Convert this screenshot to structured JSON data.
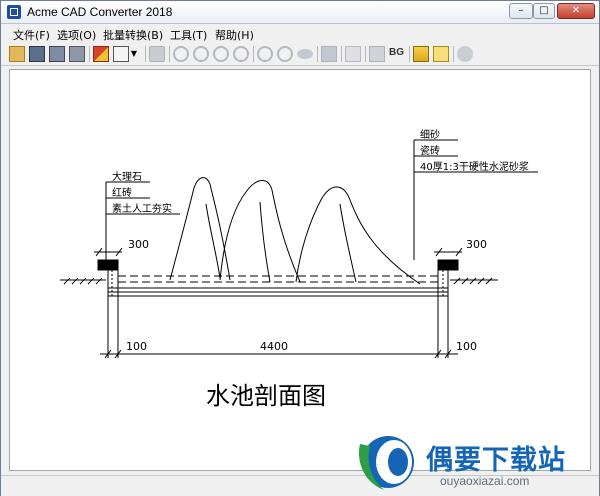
{
  "window": {
    "title": "Acme CAD Converter 2018",
    "controls": {
      "minimize": "–",
      "maximize": "□",
      "close": "✕"
    }
  },
  "menu": [
    "文件(F)",
    "选项(O)",
    "批量转换(B)",
    "工具(T)",
    "帮助(H)"
  ],
  "toolbar": {
    "icons": [
      "open-folder-icon",
      "save-icon",
      "save-all-icon",
      "print-batch-icon",
      "convert-icon",
      "layer-icon",
      "dropdown-arrow-icon",
      "print-icon",
      "zoom-out-icon",
      "zoom-in-icon",
      "zoom-window-icon",
      "zoom-previous-icon",
      "zoom-fit-icon",
      "pan-icon",
      "view-icon",
      "measure-icon",
      "layers-icon",
      "frame-icon",
      "warning-icon",
      "home-icon",
      "info-icon"
    ],
    "bg_label": "BG"
  },
  "drawing": {
    "labels_left": [
      "大理石",
      "红砖",
      "素土人工夯实"
    ],
    "labels_right": [
      "细砂",
      "瓷砖",
      "40厚1:3干硬性水泥砂浆"
    ],
    "dim_left_top": "300",
    "dim_right_top": "300",
    "dim_left_bottom": "100",
    "dim_span": "4400",
    "dim_right_bottom": "100",
    "caption": "水池剖面图"
  },
  "watermark": {
    "name": "偶要下载站",
    "url": "ouyaoxiazai.com"
  },
  "colors": {
    "accent": "#1565b6",
    "logo_green": "#2e9e45"
  }
}
